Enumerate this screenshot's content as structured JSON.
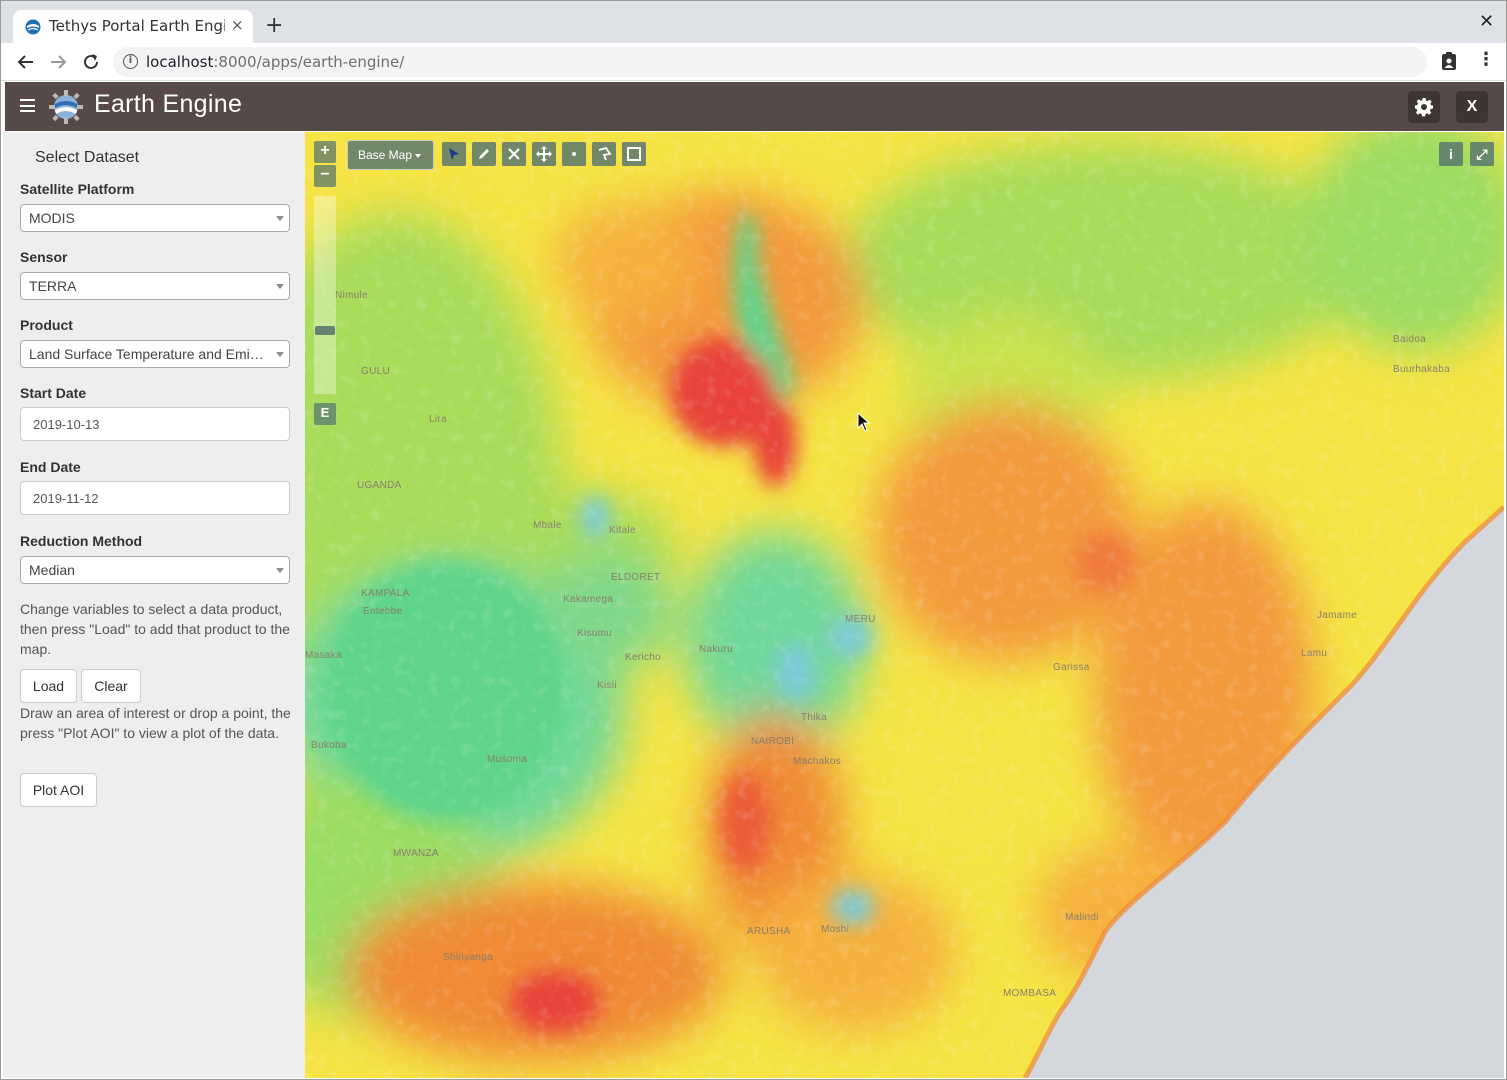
{
  "browser": {
    "tab_title": "Tethys Portal Earth Engine",
    "tab_close": "×",
    "new_tab": "+",
    "window_close": "✕",
    "url_host": "localhost",
    "url_rest": ":8000/apps/earth-engine/",
    "info_glyph": "i"
  },
  "header": {
    "title": "Earth Engine",
    "settings_icon": "gear-icon",
    "close_label": "X"
  },
  "sidebar": {
    "title": "Select Dataset",
    "platform_label": "Satellite Platform",
    "platform_value": "MODIS",
    "sensor_label": "Sensor",
    "sensor_value": "TERRA",
    "product_label": "Product",
    "product_value": "Land Surface Temperature and Emissivity",
    "start_label": "Start Date",
    "start_value": "2019-10-13",
    "end_label": "End Date",
    "end_value": "2019-11-12",
    "reduction_label": "Reduction Method",
    "reduction_value": "Median",
    "help_load": "Change variables to select a data product, then press \"Load\" to add that product to the map.",
    "load_label": "Load",
    "clear_label": "Clear",
    "help_plot": "Draw an area of interest or drop a point, the press \"Plot AOI\" to view a plot of the data.",
    "plot_label": "Plot AOI"
  },
  "map": {
    "zoom_in": "+",
    "zoom_out": "−",
    "extent_label": "E",
    "basemap_label": "Base Map",
    "info_label": "i",
    "fullscreen_label": "⤢",
    "place_labels": [
      "Nimule",
      "GULU",
      "Lira",
      "UGANDA",
      "Mbale",
      "Kitale",
      "ELDORET",
      "KAMPALA",
      "Entebbe",
      "Kakamega",
      "Kisumu",
      "Kericho",
      "Nakuru",
      "Kisii",
      "Masaka",
      "Bukoba",
      "Musoma",
      "MERU",
      "Thika",
      "NAIROBI",
      "Machakos",
      "MWANZA",
      "ARUSHA",
      "Moshi",
      "Shinyanga",
      "MOMBASA",
      "Malindi",
      "Garissa",
      "Lamu",
      "Jamame",
      "Baidoa",
      "Buurhakaba"
    ],
    "colors": {
      "hot": "#e8423a",
      "warm": "#f39a3c",
      "mid": "#f5e443",
      "cool": "#a8dc5a",
      "cold": "#5fd48a",
      "water": "#7ccbd8",
      "ocean": "#d4d8dc"
    }
  }
}
